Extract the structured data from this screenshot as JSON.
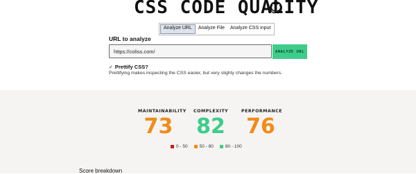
{
  "header": {
    "title": "CSS CODE QUALITY",
    "github_icon": "github-icon"
  },
  "tabs": [
    {
      "label": "Analyze URL",
      "active": true
    },
    {
      "label": "Analyze File",
      "active": false
    },
    {
      "label": "Analyze CSS input",
      "active": false
    }
  ],
  "form": {
    "url_label": "URL to analyze",
    "url_value": "https://coliss.com/",
    "analyze_button": "ANALYZE URL",
    "prettify_check": "✓",
    "prettify_label": "Prettify CSS?",
    "prettify_help": "Prettifying makes inspecting the CSS easier, but very slighty changes the numbers."
  },
  "metrics": [
    {
      "label": "MAINTAINABILITY",
      "value": "73",
      "color": "#f08c1a"
    },
    {
      "label": "COMPLEXITY",
      "value": "82",
      "color": "#3ecc8b"
    },
    {
      "label": "PERFORMANCE",
      "value": "76",
      "color": "#f08c1a"
    }
  ],
  "legend": [
    {
      "label": "0 - 50",
      "color": "#c21f1f"
    },
    {
      "label": "50 - 80",
      "color": "#f08c1a"
    },
    {
      "label": "80 - 100",
      "color": "#3ecc8b"
    }
  ],
  "section": {
    "breakdown_title": "Score breakdown"
  }
}
